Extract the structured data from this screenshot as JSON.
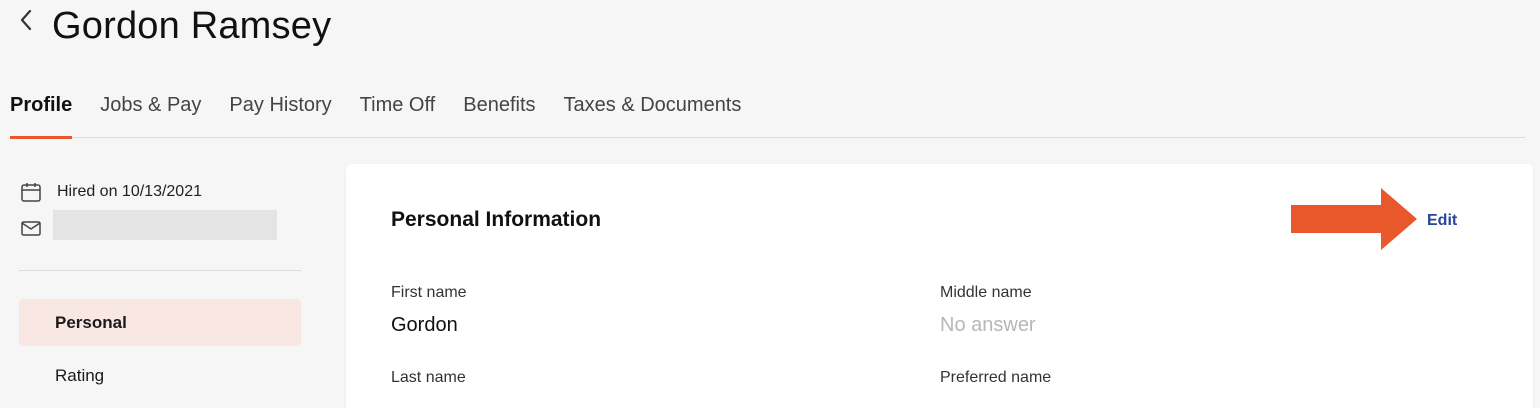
{
  "header": {
    "title": "Gordon Ramsey"
  },
  "tabs": [
    {
      "label": "Profile",
      "active": true
    },
    {
      "label": "Jobs & Pay"
    },
    {
      "label": "Pay History"
    },
    {
      "label": "Time Off"
    },
    {
      "label": "Benefits"
    },
    {
      "label": "Taxes & Documents"
    }
  ],
  "sidebar": {
    "hired": "Hired on 10/13/2021",
    "nav": [
      {
        "label": "Personal",
        "active": true
      },
      {
        "label": "Rating"
      }
    ]
  },
  "card": {
    "title": "Personal Information",
    "edit_label": "Edit",
    "fields": {
      "first_name": {
        "label": "First name",
        "value": "Gordon"
      },
      "middle_name": {
        "label": "Middle name",
        "value": "No answer"
      },
      "last_name": {
        "label": "Last name"
      },
      "preferred_name": {
        "label": "Preferred name"
      }
    }
  },
  "colors": {
    "accent": "#e8582a",
    "link": "#26469b",
    "active_nav_bg": "#f9e7e3"
  }
}
